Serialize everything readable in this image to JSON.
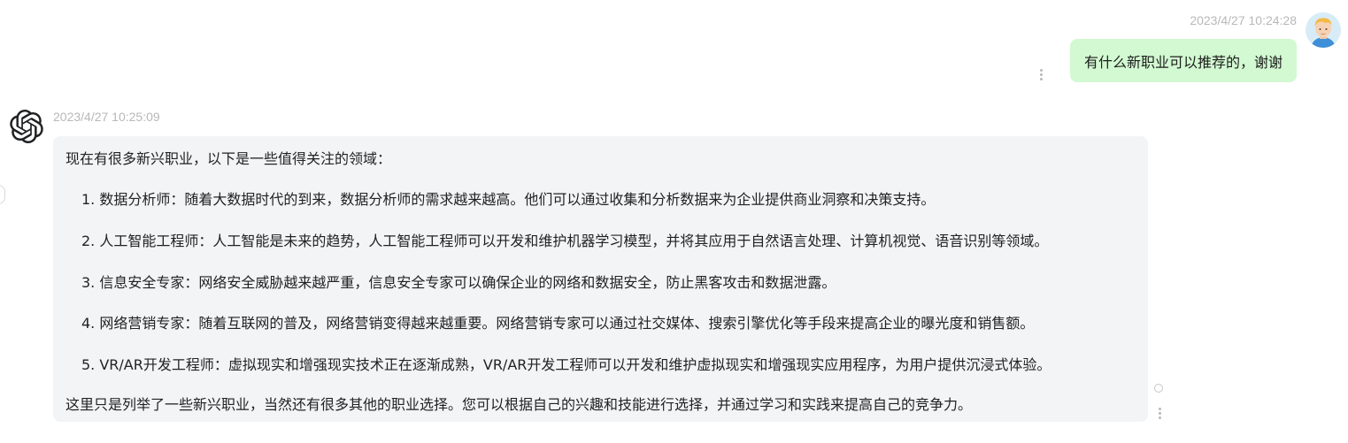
{
  "user_message": {
    "timestamp": "2023/4/27 10:24:28",
    "text": "有什么新职业可以推荐的，谢谢",
    "avatar": "user-avatar"
  },
  "bot_message": {
    "timestamp": "2023/4/27 10:25:09",
    "logo": "openai-logo-icon",
    "intro": "现在有很多新兴职业，以下是一些值得关注的领域：",
    "items": [
      "1. 数据分析师：随着大数据时代的到来，数据分析师的需求越来越高。他们可以通过收集和分析数据来为企业提供商业洞察和决策支持。",
      "2. 人工智能工程师：人工智能是未来的趋势，人工智能工程师可以开发和维护机器学习模型，并将其应用于自然语言处理、计算机视觉、语音识别等领域。",
      "3. 信息安全专家：网络安全威胁越来越严重，信息安全专家可以确保企业的网络和数据安全，防止黑客攻击和数据泄露。",
      "4. 网络营销专家：随着互联网的普及，网络营销变得越来越重要。网络营销专家可以通过社交媒体、搜索引擎优化等手段来提高企业的曝光度和销售额。",
      "5. VR/AR开发工程师：虚拟现实和增强现实技术正在逐渐成熟，VR/AR开发工程师可以开发和维护虚拟现实和增强现实应用程序，为用户提供沉浸式体验。"
    ],
    "outro": "这里只是列举了一些新兴职业，当然还有很多其他的职业选择。您可以根据自己的兴趣和技能进行选择，并通过学习和实践来提高自己的竞争力。"
  },
  "colors": {
    "user_bubble": "#d2f9d1",
    "bot_bubble": "#f3f4f6",
    "timestamp": "#b8b8b8"
  }
}
